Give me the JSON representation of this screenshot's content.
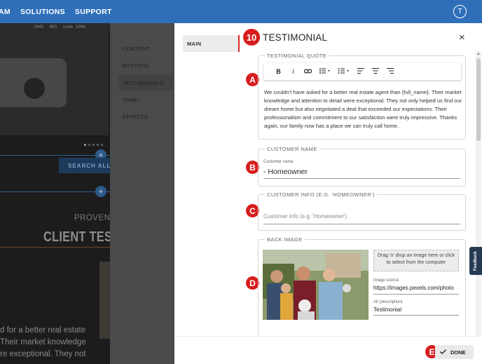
{
  "topnav": {
    "items": [
      "AM",
      "SOLUTIONS",
      "SUPPORT"
    ],
    "avatar_initial": "T"
  },
  "background": {
    "ruler_text": [
      "2045",
      "883",
      "zoom 100%"
    ],
    "search_button_label": "SEARCH ALL C",
    "proven_text": "PROVEN RES",
    "client_title": "CLIENT TESTI",
    "quote_lines": [
      "d for a better real estate",
      "Their market knowledge",
      "re exceptional. They not"
    ],
    "menu_items": [
      "CONTENT",
      "BUTTONS",
      "TESTIMONIALS",
      "PANEL",
      "EFFECTS"
    ],
    "active_menu_item": "TESTIMONIALS"
  },
  "modal": {
    "step_number": "10",
    "title": "TESTIMONIAL",
    "close_symbol": "×",
    "tabs": [
      {
        "label": "MAIN",
        "active": true
      }
    ],
    "sections": {
      "quote": {
        "legend": "TESTIMONIAL QUOTE",
        "marker": "A",
        "text": "We couldn't have asked for a better real estate agent than {full_name}. Their market knowledge and attention to detail were exceptional. They not only helped us find our dream home but also negotiated a deal that exceeded our expectations. Their professionalism and commitment to our satisfaction were truly impressive. Thanks again, our family now has a place we can truly call home.",
        "toolbar": [
          "bold",
          "italic",
          "link",
          "bullet-list",
          "numbered-list",
          "align-left",
          "align-center",
          "align-right"
        ]
      },
      "customer_name": {
        "legend": "CUSTOMER NAME",
        "marker": "B",
        "field_label": "Customer name",
        "value": "- Homeowner"
      },
      "customer_info": {
        "legend": "CUSTOMER INFO (E.G. 'HOMEOWNER')",
        "marker": "C",
        "placeholder": "Customer info (e.g. 'Homeowner')"
      },
      "back_image": {
        "legend": "BACK IMAGE",
        "marker": "D",
        "dropzone_text": "Drag 'n' drop an image here or click to select from the computer",
        "source_label": "Image source",
        "source_value": "https://images.pexels.com/photo",
        "alt_label": "Alt (description)",
        "alt_value": "Testimonial"
      }
    },
    "footer": {
      "marker": "E",
      "done_label": "DONE"
    }
  },
  "feedback_tab": "Feedback",
  "colors": {
    "topbar": "#2f6fb9",
    "marker_red": "#d71d1d",
    "accent_red": "#e02828"
  }
}
